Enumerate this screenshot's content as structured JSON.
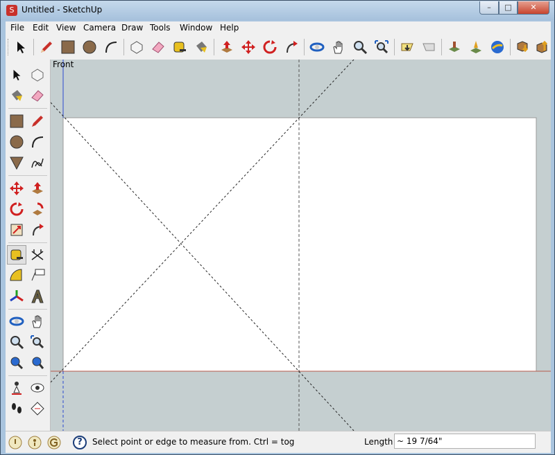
{
  "window": {
    "title": "Untitled - SketchUp",
    "app_icon_glyph": "S",
    "min_glyph": "–",
    "max_glyph": "□",
    "close_glyph": "✕"
  },
  "menu": {
    "items": [
      "File",
      "Edit",
      "View",
      "Camera",
      "Draw",
      "Tools",
      "Window",
      "Help"
    ]
  },
  "toolbar": {
    "icons": [
      "select-icon",
      "pencil-icon",
      "rectangle-icon",
      "circle-icon",
      "arc-icon",
      "make-component-icon",
      "eraser-icon",
      "tape-measure-icon",
      "paint-bucket-icon",
      "push-pull-icon",
      "move-icon",
      "rotate-icon",
      "follow-me-icon",
      "orbit-icon",
      "pan-icon",
      "zoom-icon",
      "zoom-extents-icon",
      "previous-view-icon",
      "next-view-icon",
      "add-location-icon",
      "toggle-terrain-icon",
      "google-earth-icon",
      "get-models-icon",
      "share-model-icon"
    ]
  },
  "viewport": {
    "scene_label": "Front",
    "colors": {
      "sky": "#c5cfd0",
      "page": "#ffffff",
      "ground_line": "#b55a4a",
      "guide": "#000000"
    }
  },
  "status": {
    "message": "Select point or edge to measure from.  Ctrl = tog",
    "help_glyph": "?",
    "length_label": "Length",
    "length_value": "~ 19 7/64\""
  }
}
